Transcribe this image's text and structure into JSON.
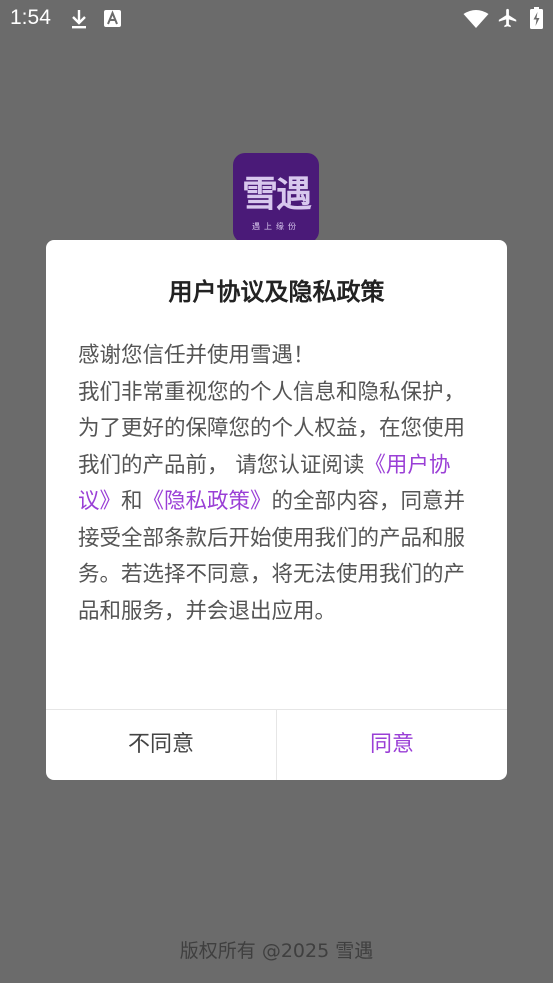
{
  "status_bar": {
    "time": "1:54",
    "icons": [
      "download-icon",
      "a-badge-icon",
      "wifi-icon",
      "airplane-icon",
      "battery-icon"
    ]
  },
  "app_logo": {
    "text": "雪遇",
    "subtext": "遇上缘份"
  },
  "dialog": {
    "title": "用户协议及隐私政策",
    "body": {
      "line1": "感谢您信任并使用雪遇！",
      "part1": "我们非常重视您的个人信息和隐私保护，为了更好的保障您的个人权益，在您使用我们的产品前， 请您认证阅读",
      "link_user_agreement": "《用户协议》",
      "and": "和",
      "link_privacy_policy": "《隐私政策》",
      "part2": "的全部内容，同意并接受全部条款后开始使用我们的产品和服务。若选择不同意，将无法使用我们的产品和服务，并会退出应用。"
    },
    "disagree_label": "不同意",
    "agree_label": "同意"
  },
  "footer": {
    "copyright": "版权所有 @2025  雪遇"
  },
  "colors": {
    "overlay_bg": "#6b6b6b",
    "accent": "#9a3fd6",
    "logo_bg": "#4a1a78"
  }
}
